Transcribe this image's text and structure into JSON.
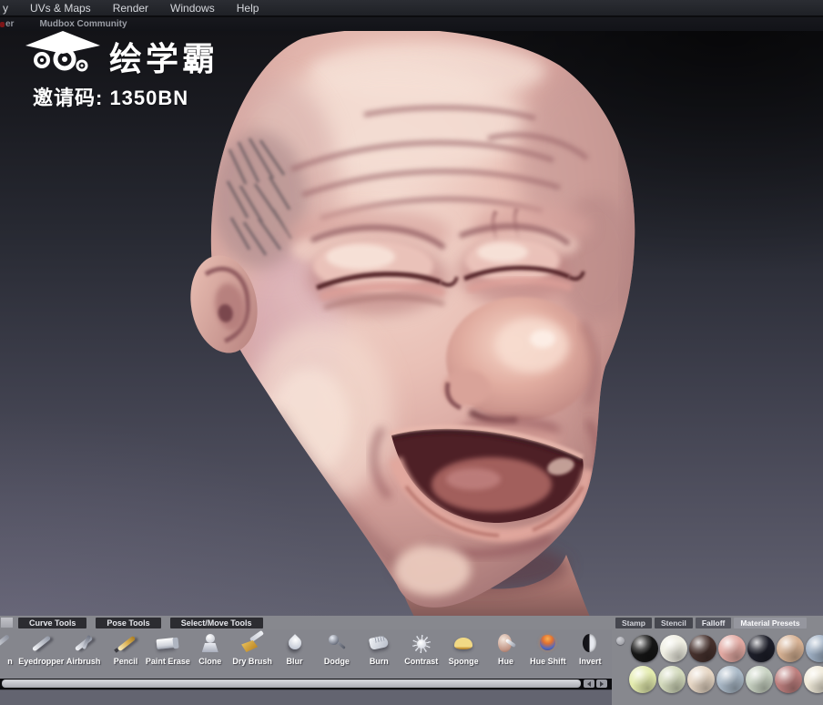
{
  "menu_bar": {
    "partial_item": "y",
    "items": [
      "UVs & Maps",
      "Render",
      "Windows",
      "Help"
    ]
  },
  "community_bar": {
    "partial_item": "er",
    "tab": "Mudbox Community"
  },
  "watermark": {
    "brand": "绘学霸",
    "invite_code": "邀请码: 1350BN"
  },
  "tool_tabs": [
    "Curve Tools",
    "Pose Tools",
    "Select/Move Tools"
  ],
  "right_tabs": [
    "Stamp",
    "Stencil",
    "Falloff",
    "Material Presets"
  ],
  "right_tabs_selected": "Material Presets",
  "tools": {
    "partial_label": "n",
    "items": [
      {
        "name": "eyedropper",
        "label": "Eyedropper"
      },
      {
        "name": "airbrush",
        "label": "Airbrush"
      },
      {
        "name": "pencil",
        "label": "Pencil"
      },
      {
        "name": "paint-erase",
        "label": "Paint Erase"
      },
      {
        "name": "clone",
        "label": "Clone"
      },
      {
        "name": "dry-brush",
        "label": "Dry Brush"
      },
      {
        "name": "blur",
        "label": "Blur"
      },
      {
        "name": "dodge",
        "label": "Dodge"
      },
      {
        "name": "burn",
        "label": "Burn"
      },
      {
        "name": "contrast",
        "label": "Contrast"
      },
      {
        "name": "sponge",
        "label": "Sponge"
      },
      {
        "name": "hue",
        "label": "Hue"
      },
      {
        "name": "hue-shift",
        "label": "Hue Shift"
      },
      {
        "name": "invert",
        "label": "Invert"
      }
    ]
  },
  "materials": {
    "row1": [
      "#161616",
      "#efeee2",
      "#46312d",
      "#e2a9a2",
      "#1d1e29",
      "#d6b193",
      "#9fb0c4"
    ],
    "row2": [
      "#e4ecae",
      "#d3dabc",
      "#e6d6c4",
      "#a9b8c6",
      "#c8d2c2",
      "#bd7f7e",
      "#efe9d8"
    ]
  },
  "colors": {
    "tray_bg": "#85868d",
    "viewport_top": "#131317",
    "viewport_bottom": "#616170",
    "skin_highlight": "#f4dcd2",
    "skin_shadow": "#96686c"
  }
}
